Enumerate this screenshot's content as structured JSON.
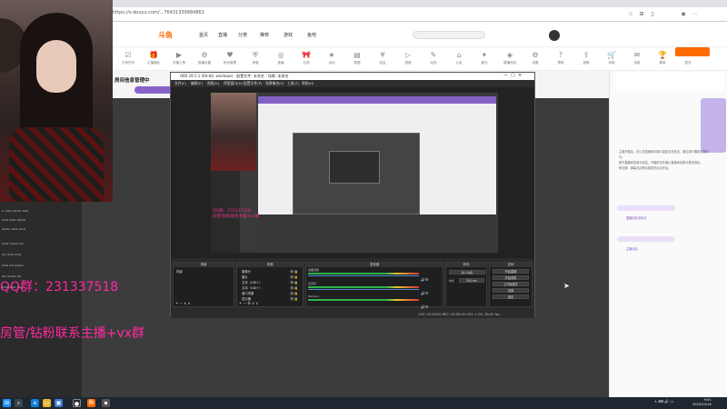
{
  "browser": {
    "url": "https://v.douyu.com/...76431339984862",
    "toolbar_icons": [
      "star-icon",
      "extension-icon",
      "sidebar-icon",
      "profile-icon",
      "more-icon"
    ]
  },
  "site": {
    "logo": "斗鱼",
    "nav": [
      "首页",
      "直播",
      "分类",
      "推荐",
      "游戏",
      "鱼吧"
    ],
    "tools": [
      "日常任务",
      "主播福利",
      "开播工具",
      "直播设置",
      "粉丝管理",
      "房管",
      "鱼塘",
      "礼物",
      "活动",
      "数据",
      "收益",
      "视频",
      "动态",
      "公会",
      "星光",
      "直播伴侣",
      "设置",
      "帮助",
      "投稿",
      "商城",
      "消息",
      "赛事",
      "更多"
    ],
    "room_title": "房间信息管理中",
    "right_panel_lines": [
      "主播开播后，可以在直播间向观众发起互动玩法，通过观众赠送礼物参与，",
      "提升直播间热度与收益。开播前请先确认直播间设置与推流地址，",
      "粉丝牌、弹幕互动等功能需在后台开启。"
    ],
    "right_chips": [
      "直播间互动玩法",
      "主播活动"
    ]
  },
  "obs": {
    "title": "OBS 29.1.1 (64-bit, windows) - 配置文件: 未命名 - 场景: 未命名",
    "menu": [
      "文件(F)",
      "编辑(E)",
      "视图(V)",
      "停靠窗口(D)",
      "配置文件(P)",
      "场景集合(S)",
      "工具(T)",
      "帮助(H)"
    ],
    "preview_pink": [
      "QQ群：231337518",
      "房管/钻粉联系主播+vx群"
    ],
    "docks": {
      "scenes": "场景",
      "sources": "来源",
      "mixer": "混音器",
      "transitions": "转场",
      "controls": "控制"
    },
    "scene_name": "场景",
    "sources": [
      "摄像头",
      "图片",
      "文本（GDI+）",
      "文本（GDI+）",
      "窗口采集",
      "显示器"
    ],
    "mixer_tracks": [
      {
        "name": "桌面音频",
        "db": "0.0 dB"
      },
      {
        "name": "麦克风",
        "db": "0.0 dB"
      },
      {
        "name": "Mic/Aux",
        "db": "0.0 dB"
      }
    ],
    "transition": "淡入淡出",
    "duration_label": "时长",
    "duration": "300 ms",
    "controls": [
      "开始直播",
      "开始录制",
      "工作室模式",
      "设置",
      "退出"
    ],
    "status": "LIVE: 00:00:00     REC: 00:00:00     CPU: 1.3%, 60.00 fps"
  },
  "overlay": {
    "qq": "QQ群：231337518",
    "line2": "房管/钻粉联系主播+vx群"
  },
  "taskbar": {
    "apps": [
      "windows-icon",
      "search-icon",
      "edge-icon",
      "folder-icon",
      "store-icon",
      "obs-icon",
      "douyu-icon",
      "app-icon"
    ],
    "time": "9:01",
    "date": "2023/10/16"
  },
  "colors": {
    "accent_pink": "#ff2aa3",
    "douyu_orange": "#ff6a00",
    "purple": "#8360c3"
  }
}
